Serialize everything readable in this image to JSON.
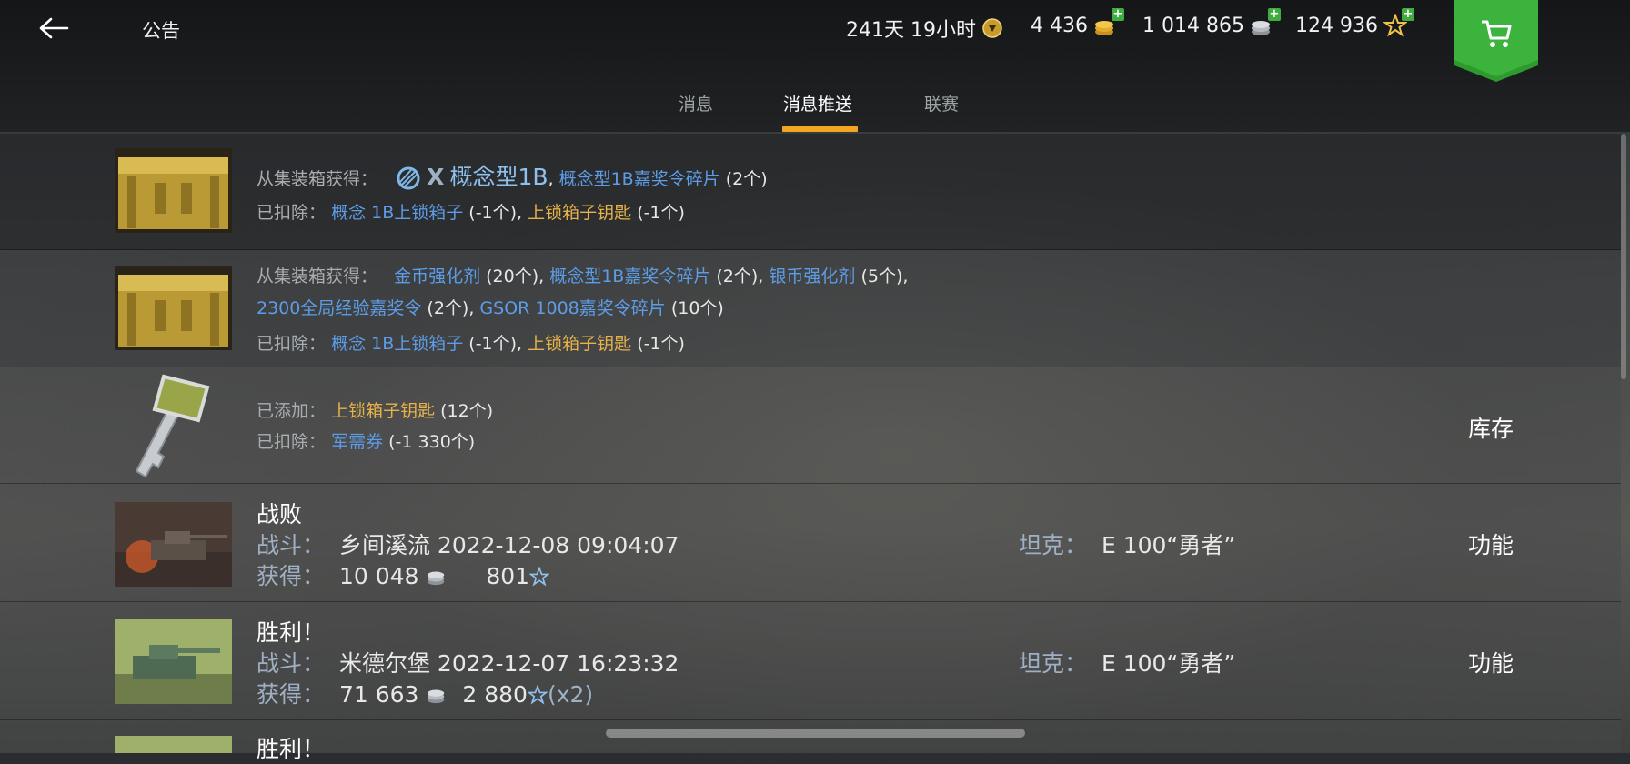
{
  "header": {
    "title": "公告",
    "premium_time": "241天 19小时",
    "gold": "4 436",
    "credits": "1 014 865",
    "free_xp": "124 936"
  },
  "tabs": [
    {
      "label": "消息",
      "active": false
    },
    {
      "label": "消息推送",
      "active": true
    },
    {
      "label": "联赛",
      "active": false
    }
  ],
  "accent_color": "#f2a623",
  "rows": [
    {
      "type": "container",
      "l1_label": "从集装箱获得：",
      "l1_tier": "X",
      "l1_vehicle": "概念型1B",
      "l1_sep": ",",
      "l1_item": "概念型1B嘉奖令碎片",
      "l1_qty": "(2个)",
      "l2_label": "已扣除：",
      "l2_item1": "概念 1B上锁箱子",
      "l2_qty1": "(-1个),",
      "l2_item2": "上锁箱子钥匙",
      "l2_qty2": "(-1个)"
    },
    {
      "type": "container",
      "l1_label": "从集装箱获得：",
      "l1_item1": "金币强化剂",
      "l1_qty1": "(20个),",
      "l1_item2": "概念型1B嘉奖令碎片",
      "l1_qty2": "(2个),",
      "l1_item3": "银币强化剂",
      "l1_qty3": "(5个),",
      "l2_item1": "2300全局经验嘉奖令",
      "l2_qty1": "(2个),",
      "l2_item2": "GSOR 1008嘉奖令碎片",
      "l2_qty2": "(10个)",
      "l3_label": "已扣除：",
      "l3_item1": "概念 1B上锁箱子",
      "l3_qty1": "(-1个),",
      "l3_item2": "上锁箱子钥匙",
      "l3_qty2": "(-1个)"
    },
    {
      "type": "key",
      "l1_label": "已添加：",
      "l1_item": "上锁箱子钥匙",
      "l1_qty": "(12个)",
      "l2_label": "已扣除：",
      "l2_item": "军需券",
      "l2_qty": "(-1 330个)",
      "action": "库存"
    },
    {
      "type": "battle",
      "result": "战败",
      "battle_label": "战斗：",
      "map_time": "乡间溪流 2022-12-08 09:04:07",
      "earn_label": "获得：",
      "credits": "10 048",
      "xp": "801",
      "xp_suffix": "",
      "tank_label": "坦克：",
      "tank": "E 100“勇者”",
      "action": "功能"
    },
    {
      "type": "battle",
      "result": "胜利！",
      "battle_label": "战斗：",
      "map_time": "米德尔堡 2022-12-07 16:23:32",
      "earn_label": "获得：",
      "credits": "71 663",
      "xp": "2 880",
      "xp_suffix": "(x2)",
      "tank_label": "坦克：",
      "tank": "E 100“勇者”",
      "action": "功能"
    },
    {
      "type": "battle-partial",
      "result": "胜利！"
    }
  ]
}
